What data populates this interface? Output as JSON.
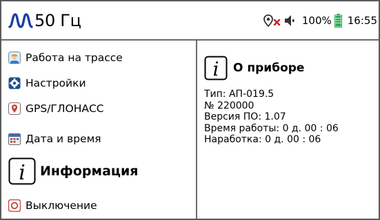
{
  "statusbar": {
    "frequency_label": "50 Гц",
    "battery_percent": "100%",
    "time": "16:55",
    "icons": [
      "waveform-logo-icon",
      "gps-off-icon",
      "volume-low-icon",
      "battery-full-icon"
    ],
    "colors": {
      "logo": "#1a3fa6",
      "gps_off": "#cc2222",
      "battery": "#2fa84f"
    }
  },
  "menu": {
    "items": [
      {
        "label": "Работа на трассе",
        "icon": "worker-icon"
      },
      {
        "label": "Настройки",
        "icon": "gear-icon"
      },
      {
        "label": "GPS/ГЛОНАСС",
        "icon": "location-pin-icon"
      },
      {
        "label": "Дата и время",
        "icon": "calendar-icon"
      },
      {
        "label": "Информация",
        "icon": "info-icon",
        "active": true
      },
      {
        "label": "Выключение",
        "icon": "power-icon"
      }
    ]
  },
  "panel": {
    "title": "О приборе",
    "rows": [
      "Тип: АП-019.5",
      "№  220000",
      "Версия ПО: 1.07",
      "Время работы:  0 д. 00 : 06",
      "Наработка:  0 д. 00 : 06"
    ]
  }
}
